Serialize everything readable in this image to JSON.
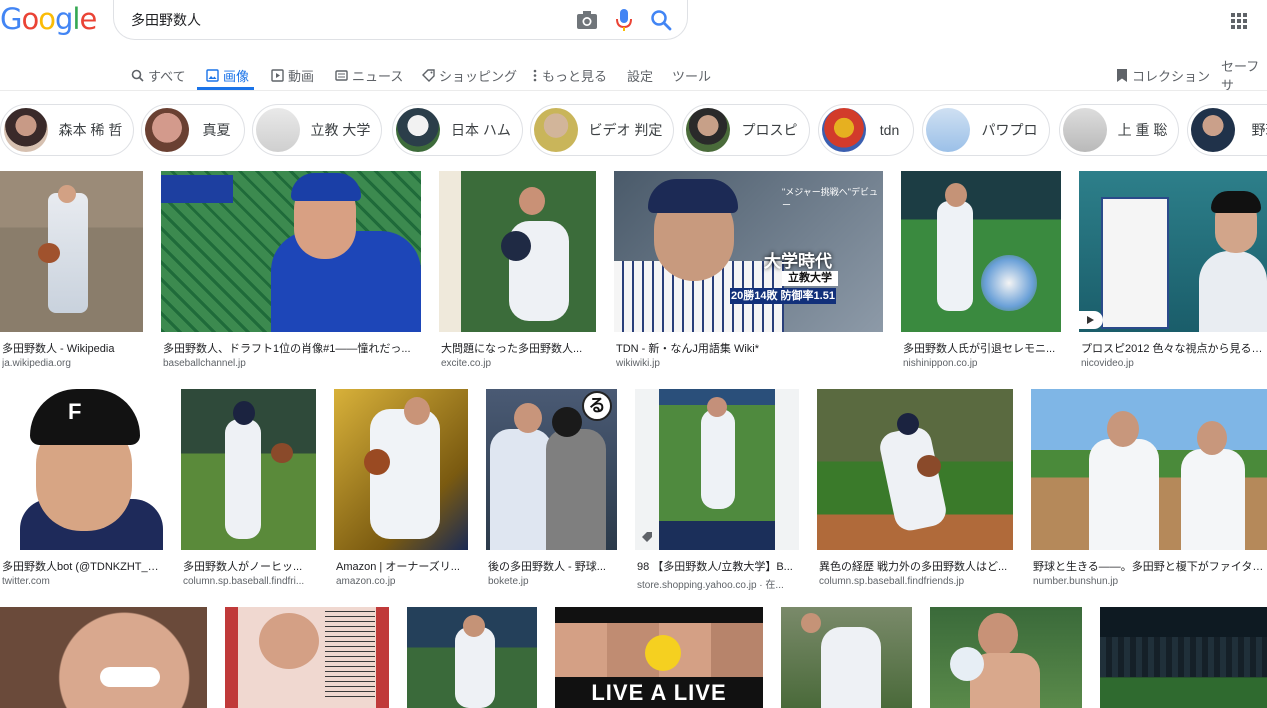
{
  "logo": [
    "G",
    "o",
    "o",
    "g",
    "l",
    "e"
  ],
  "search": {
    "query": "多田野数人"
  },
  "tabs": [
    {
      "label": "すべて",
      "icon": "search-icon"
    },
    {
      "label": "画像",
      "icon": "image-icon"
    },
    {
      "label": "動画",
      "icon": "video-icon"
    },
    {
      "label": "ニュース",
      "icon": "news-icon"
    },
    {
      "label": "ショッピング",
      "icon": "tag-icon"
    },
    {
      "label": "もっと見る",
      "icon": "more-vert-icon"
    },
    {
      "label": "設定"
    },
    {
      "label": "ツール"
    }
  ],
  "right_links": {
    "collections": "コレクション",
    "safesearch": "セーフサ"
  },
  "chips": [
    "森本 稀 哲",
    "真夏",
    "立教 大学",
    "日本 ハム",
    "ビデオ 判定",
    "プロスピ",
    "tdn",
    "パワプロ",
    "上 重 聡",
    "野球"
  ],
  "results_row1": [
    {
      "title": "多田野数人 - Wikipedia",
      "source": "ja.wikipedia.org"
    },
    {
      "title": "多田野数人、ドラフト1位の肖像#1——憧れだっ...",
      "source": "baseballchannel.jp"
    },
    {
      "title": "大問題になった多田野数人...",
      "source": "excite.co.jp"
    },
    {
      "title": "TDN - 新・なんJ用語集 Wiki*",
      "source": "wikiwiki.jp",
      "overlay_title": "立教大学",
      "overlay_stats": "20勝14敗 防御率1.51",
      "overlay_big": "大学時代",
      "overlay_small": "\"メジャー挑戦へ\"デビュー"
    },
    {
      "title": "多田野数人氏が引退セレモニ...",
      "source": "nishinippon.co.jp"
    },
    {
      "title": "プロスピ2012 色々な視点から見るイ...",
      "source": "nicovideo.jp"
    }
  ],
  "results_row2": [
    {
      "title": "多田野数人bot (@TDNKZHT_) ...",
      "source": "twitter.com"
    },
    {
      "title": "多田野数人がノーヒッ...",
      "source": "column.sp.baseball.findfri..."
    },
    {
      "title": "Amazon | オーナーズリ...",
      "source": "amazon.co.jp"
    },
    {
      "title": "後の多田野数人 - 野球...",
      "source": "bokete.jp"
    },
    {
      "title": "98 【多田野数人/立教大学】B...",
      "source": "store.shopping.yahoo.co.jp · 在..."
    },
    {
      "title": "異色の経歴 戦力外の多田野数人はど...",
      "source": "column.sp.baseball.findfriends.jp"
    },
    {
      "title": "野球と生きる——。多田野と榎下がファイター...",
      "source": "number.bunshun.jp"
    }
  ],
  "row3_overlay": "LIVE A LIVE",
  "row3_badge": "る",
  "colors": {
    "accent": "#1a73e8",
    "text": "#202124",
    "muted": "#5f6368"
  }
}
